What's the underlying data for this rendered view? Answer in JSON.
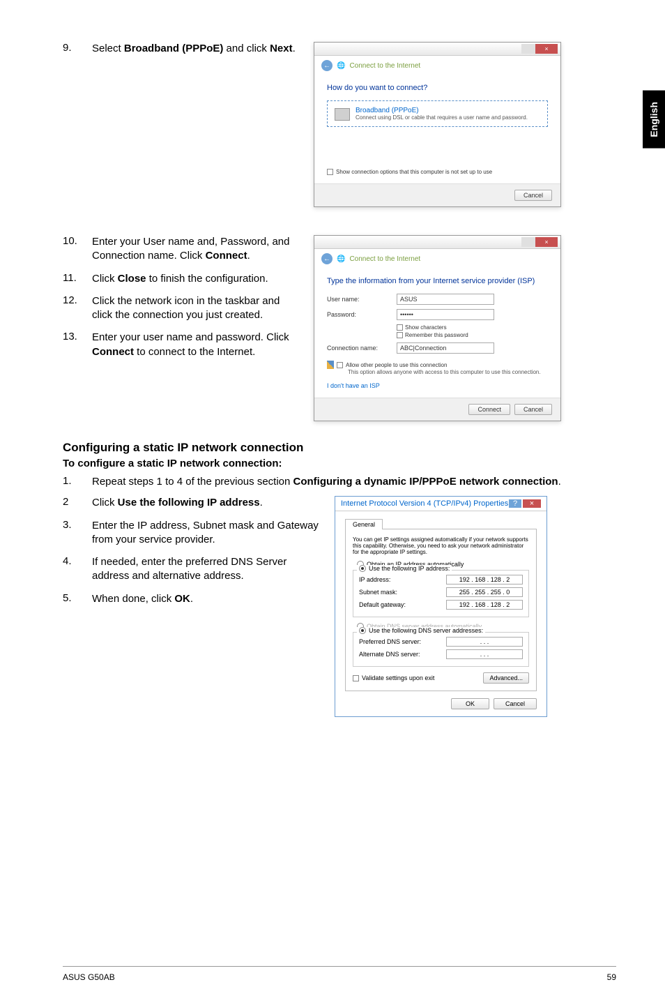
{
  "sideTab": "English",
  "section1": {
    "num": "9.",
    "text_pre": "Select ",
    "text_bold": "Broadband (PPPoE)",
    "text_mid": " and click ",
    "text_bold2": "Next",
    "text_post": "."
  },
  "dialog1": {
    "breadcrumb": "Connect to the Internet",
    "heading": "How do you want to connect?",
    "option_title": "Broadband (PPPoE)",
    "option_desc": "Connect using DSL or cable that requires a user name and password.",
    "show_options": "Show connection options that this computer is not set up to use",
    "cancel": "Cancel"
  },
  "steps_mid": [
    {
      "num": "10.",
      "html": "Enter your User name and, Password, and Connection name. Click <b>Connect</b>."
    },
    {
      "num": "11.",
      "html": "Click <b>Close</b> to finish the configuration."
    },
    {
      "num": "12.",
      "html": "Click the network icon in the taskbar and click the connection you just created."
    },
    {
      "num": "13.",
      "html": "Enter your user name and password. Click <b>Connect</b> to connect to the Internet."
    }
  ],
  "dialog2": {
    "breadcrumb": "Connect to the Internet",
    "heading": "Type the information from your Internet service provider (ISP)",
    "user_label": "User name:",
    "user_value": "ASUS",
    "pass_label": "Password:",
    "pass_value": "••••••",
    "show_chars": "Show characters",
    "remember": "Remember this password",
    "conn_label": "Connection name:",
    "conn_value": "ABC|Connection",
    "allow_other": "Allow other people to use this connection",
    "allow_desc": "This option allows anyone with access to this computer to use this connection.",
    "no_isp": "I don't have an ISP",
    "connect": "Connect",
    "cancel": "Cancel"
  },
  "heading2": "Configuring a static IP network connection",
  "heading3": "To configure a static IP network connection:",
  "step_b1": {
    "num": "1.",
    "html": "Repeat steps 1 to 4 of the previous section <b>Configuring a dynamic IP/PPPoE network connection</b>."
  },
  "steps_bottom": [
    {
      "num": "2",
      "html": "Click <b>Use the following IP address</b>."
    },
    {
      "num": "3.",
      "html": "Enter the IP address, Subnet mask and Gateway from your service provider."
    },
    {
      "num": "4.",
      "html": "If needed, enter the preferred DNS Server address and alternative address."
    },
    {
      "num": "5.",
      "html": "When done, click <b>OK</b>."
    }
  ],
  "ipv4": {
    "title": "Internet Protocol Version 4 (TCP/IPv4) Properties",
    "tab": "General",
    "desc": "You can get IP settings assigned automatically if your network supports this capability. Otherwise, you need to ask your network administrator for the appropriate IP settings.",
    "obtain_ip": "Obtain an IP address automatically",
    "use_ip": "Use the following IP address:",
    "ip_label": "IP address:",
    "ip_value": "192 . 168 . 128 .   2",
    "subnet_label": "Subnet mask:",
    "subnet_value": "255 . 255 . 255 .   0",
    "gateway_label": "Default gateway:",
    "gateway_value": "192 . 168 . 128 .   2",
    "obtain_dns": "Obtain DNS server address automatically",
    "use_dns": "Use the following DNS server addresses:",
    "pref_dns_label": "Preferred DNS server:",
    "pref_dns_value": ".       .       .",
    "alt_dns_label": "Alternate DNS server:",
    "alt_dns_value": ".       .       .",
    "validate": "Validate settings upon exit",
    "advanced": "Advanced...",
    "ok": "OK",
    "cancel": "Cancel"
  },
  "footer": {
    "left": "ASUS G50AB",
    "right": "59"
  }
}
